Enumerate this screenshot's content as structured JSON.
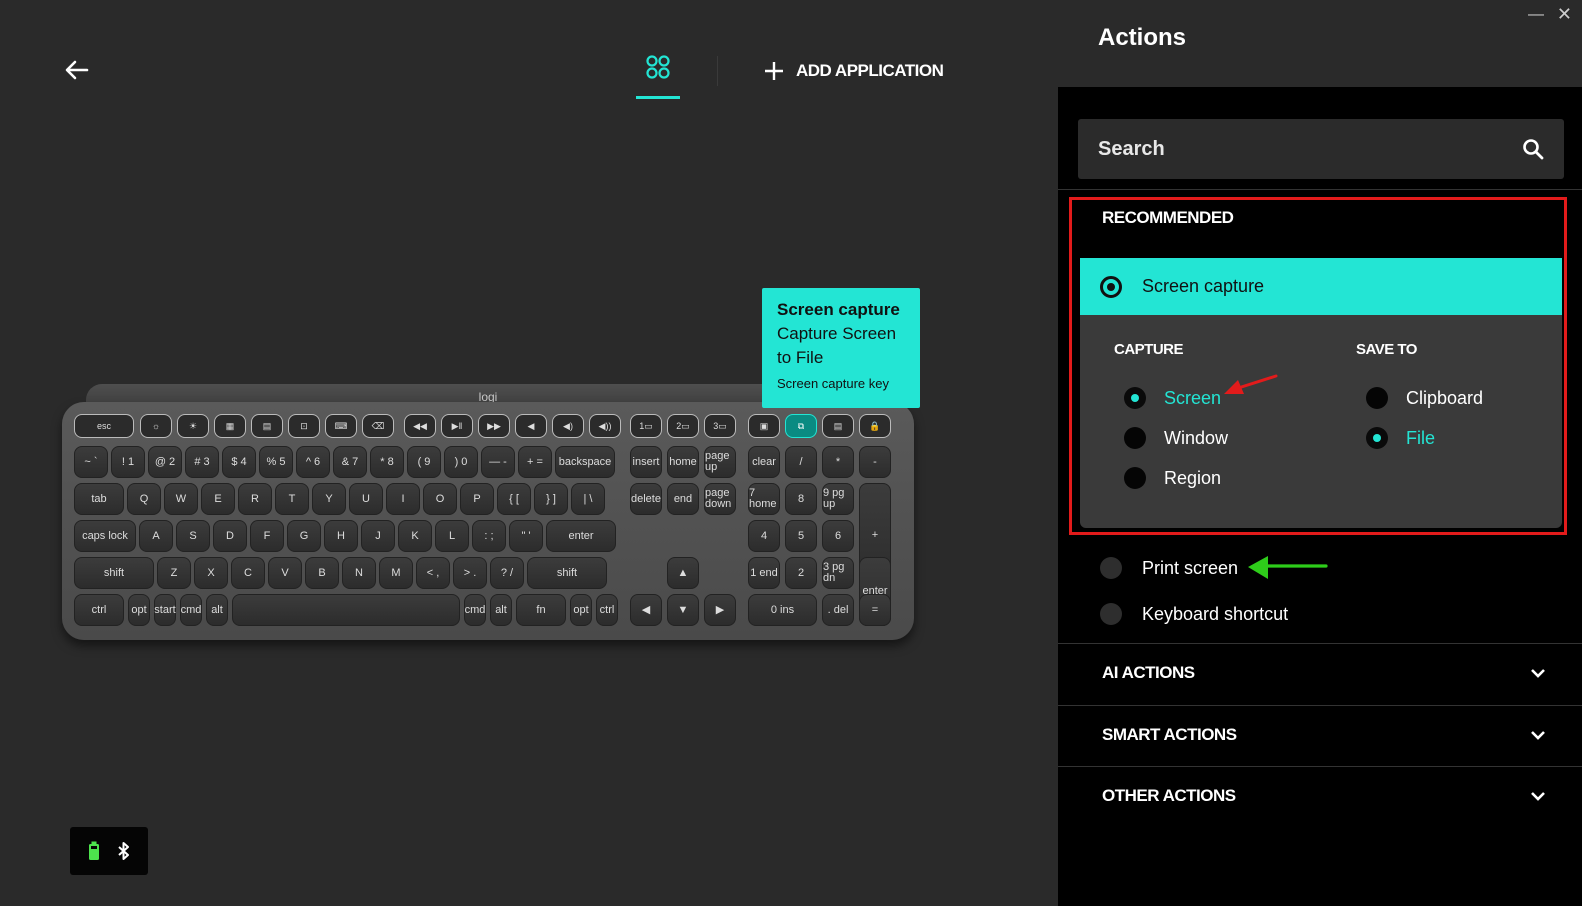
{
  "header": {
    "add_application_label": "ADD APPLICATION"
  },
  "keyboard": {
    "brand": "logi",
    "fn_row": [
      "esc",
      "☼",
      "☀",
      "▦",
      "▤",
      "⊡",
      "⌨",
      "⌫",
      "◀◀",
      "▶‖",
      "▶▶",
      "◀",
      "◀)",
      "◀))",
      "1▭",
      "2▭",
      "3▭",
      "▣",
      "⧉",
      "▤",
      "🔒"
    ],
    "row1": [
      "~ `",
      "! 1",
      "@ 2",
      "# 3",
      "$ 4",
      "% 5",
      "^ 6",
      "& 7",
      "* 8",
      "( 9",
      ") 0",
      "— -",
      "+ =",
      "backspace"
    ],
    "row2": [
      "tab",
      "Q",
      "W",
      "E",
      "R",
      "T",
      "Y",
      "U",
      "I",
      "O",
      "P",
      "{ [",
      "} ]",
      "| \\"
    ],
    "row3": [
      "caps lock",
      "A",
      "S",
      "D",
      "F",
      "G",
      "H",
      "J",
      "K",
      "L",
      ": ;",
      "\" '",
      "enter"
    ],
    "row4": [
      "shift",
      "Z",
      "X",
      "C",
      "V",
      "B",
      "N",
      "M",
      "< ,",
      "> .",
      "? /",
      "shift"
    ],
    "row5": [
      "ctrl",
      "opt",
      "start",
      "cmd",
      "alt",
      "",
      "cmd",
      "alt",
      "fn",
      "opt",
      "ctrl"
    ],
    "nav_keys": [
      "insert",
      "home",
      "page up",
      "delete",
      "end",
      "page down"
    ],
    "numpad": [
      "clear",
      "/",
      "*",
      "-",
      "7 home",
      "8",
      "9 pg up",
      "+",
      "4",
      "5",
      "6",
      "1 end",
      "2",
      "3 pg dn",
      "enter",
      "0 ins",
      ". del",
      "="
    ]
  },
  "tooltip": {
    "title": "Screen capture",
    "line1": "Capture Screen",
    "line2": "to File",
    "caption": "Screen capture key"
  },
  "panel": {
    "title": "Actions",
    "search_placeholder": "Search",
    "recommended_label": "RECOMMENDED",
    "selected_action": "Screen capture",
    "capture": {
      "title": "CAPTURE",
      "options": [
        {
          "label": "Screen",
          "selected": true
        },
        {
          "label": "Window",
          "selected": false
        },
        {
          "label": "Region",
          "selected": false
        }
      ]
    },
    "save_to": {
      "title": "SAVE TO",
      "options": [
        {
          "label": "Clipboard",
          "selected": false
        },
        {
          "label": "File",
          "selected": true
        }
      ]
    },
    "other_recommended": [
      {
        "label": "Print screen"
      },
      {
        "label": "Keyboard shortcut"
      }
    ],
    "sections": [
      {
        "label": "AI ACTIONS"
      },
      {
        "label": "SMART ACTIONS"
      },
      {
        "label": "OTHER ACTIONS"
      }
    ]
  },
  "colors": {
    "accent": "#23e5d4",
    "highlight_box": "#e21b1b",
    "annotation_red": "#e21b1b",
    "annotation_green": "#2ecc1a",
    "panel_bg": "#000000",
    "canvas_bg": "#2a2a2a"
  },
  "icons": {
    "back": "arrow-left-icon",
    "apps": "apps-grid-icon",
    "add": "plus-icon",
    "search": "search-icon",
    "chevron": "chevron-down-icon",
    "battery": "battery-icon",
    "bluetooth": "bluetooth-icon"
  }
}
